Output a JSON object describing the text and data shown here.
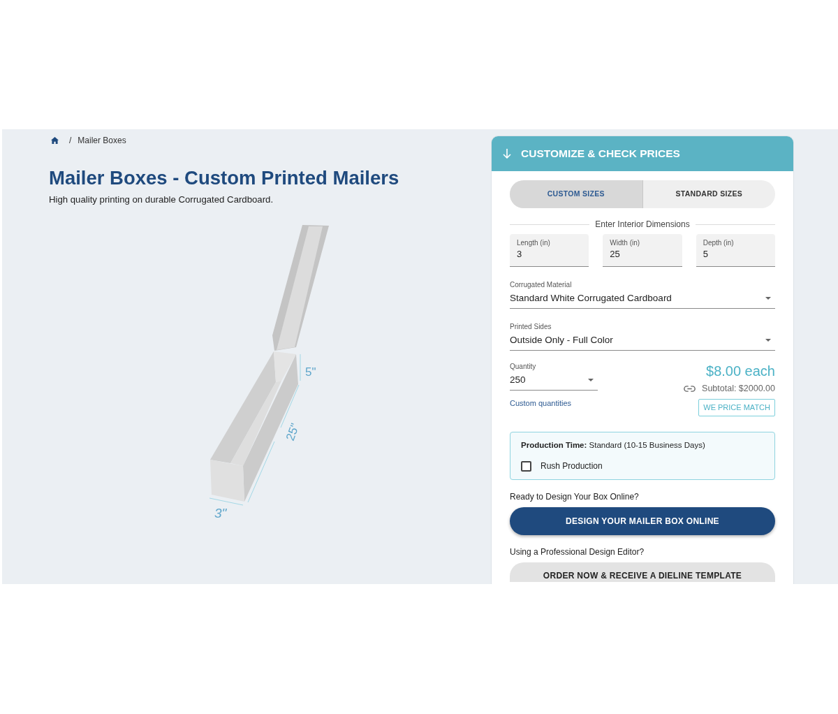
{
  "breadcrumb": {
    "separator": "/",
    "current": "Mailer Boxes"
  },
  "title": "Mailer Boxes - Custom Printed Mailers",
  "subtitle": "High quality printing on durable Corrugated Cardboard.",
  "box_preview": {
    "dimension_labels": {
      "depth": "5\"",
      "width": "25\"",
      "length": "3\""
    }
  },
  "customizer": {
    "header": "CUSTOMIZE & CHECK PRICES",
    "tabs": [
      {
        "label": "CUSTOM SIZES",
        "selected": true
      },
      {
        "label": "STANDARD SIZES",
        "selected": false
      }
    ],
    "dimensions_heading": "Enter Interior Dimensions",
    "dimension_fields": [
      {
        "label": "Length (in)",
        "value": "3"
      },
      {
        "label": "Width (in)",
        "value": "25"
      },
      {
        "label": "Depth (in)",
        "value": "5"
      }
    ],
    "selects": [
      {
        "label": "Corrugated Material",
        "value": "Standard White Corrugated Cardboard"
      },
      {
        "label": "Printed Sides",
        "value": "Outside Only - Full Color"
      }
    ],
    "quantity": {
      "label": "Quantity",
      "value": "250"
    },
    "custom_quantities_link": "Custom quantities",
    "price": "$8.00 each",
    "subtotal": "Subtotal: $2000.00",
    "price_match_button": "WE PRICE MATCH",
    "production": {
      "text": "**Production Time:** Standard (10-15 Business Days)",
      "options": [
        {
          "label": "Rush Production",
          "checked": false
        }
      ]
    },
    "design_online": {
      "prompt": "Ready to Design Your Box Online?",
      "button": "DESIGN YOUR MAILER BOX ONLINE"
    },
    "dieline": {
      "prompt": "Using a Professional Design Editor?",
      "button": "ORDER NOW & RECEIVE A DIELINE TEMPLATE"
    }
  }
}
